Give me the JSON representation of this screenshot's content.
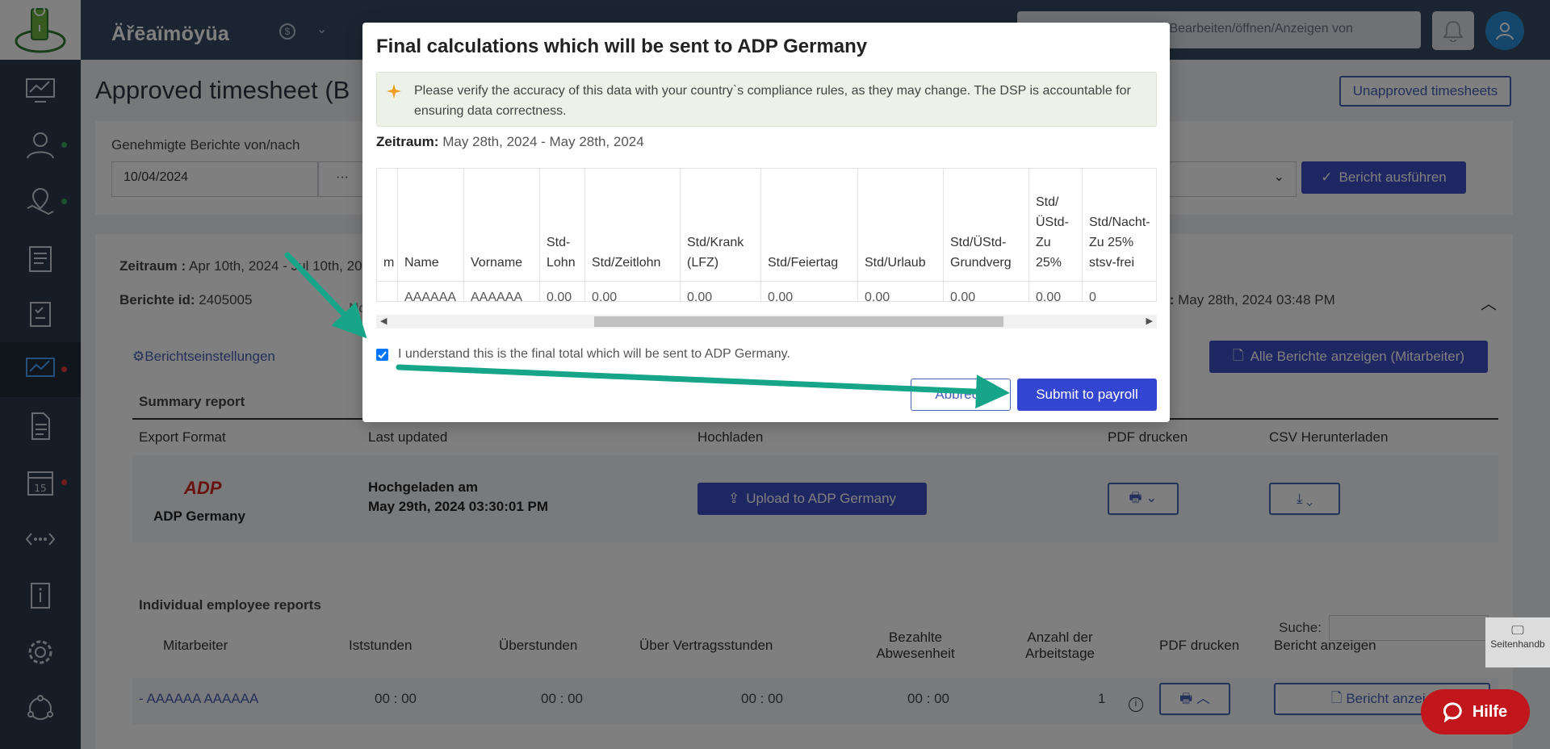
{
  "app": {
    "brand": "Äřēaïmöyüa",
    "search_placeholder": "/Bearbeiten/öffnen/Anzeigen von",
    "help_label": "Hilfe",
    "handbook_label": "Seitenhandb"
  },
  "page": {
    "title": "Approved timesheet (B",
    "unapproved_button": "Unapproved timesheets",
    "filter_label": "Genehmigte Berichte von/nach",
    "date_from": "10/04/2024",
    "date_sep": "···",
    "run_report_button": "Bericht ausführen",
    "period_label": "Zeitraum :",
    "period_value": "Apr 10th, 2024 - Jul 10th, 20",
    "report_id_label": "Berichte id:",
    "report_id_value": "2405005",
    "report_id_extra": "No",
    "date_right_label": "i:",
    "date_right_value": "May 28th, 2024 03:48 PM",
    "settings_link": "Berichtseinstellungen",
    "all_reports_button": "Alle Berichte anzeigen (Mitarbeiter)"
  },
  "summary": {
    "title": "Summary report",
    "headers": [
      "Export Format",
      "Last updated",
      "Hochladen",
      "PDF drucken",
      "CSV Herunterladen"
    ],
    "export_name": "ADP Germany",
    "uploaded_line1": "Hochgeladen am",
    "uploaded_line2": "May 29th, 2024 03:30:01 PM",
    "upload_button": "Upload to ADP Germany"
  },
  "individual": {
    "title": "Individual employee reports",
    "search_label": "Suche:",
    "headers": [
      "Mitarbeiter",
      "Iststunden",
      "Überstunden",
      "Über Vertragsstunden",
      "Bezahlte Abwesenheit",
      "Anzahl der Arbeitstage",
      "PDF drucken",
      "Bericht anzeigen"
    ],
    "row": {
      "employee": "- AAAAAA AAAAAA",
      "ist": "00 : 00",
      "ueber": "00 : 00",
      "vertrag": "00 : 00",
      "abwesenheit": "00 : 00",
      "tage": "1",
      "view_button": "Bericht anzeig"
    }
  },
  "modal": {
    "title": "Final calculations which will be sent to ADP Germany",
    "notice": "Please verify the accuracy of this data with your country`s compliance rules, as they may change. The DSP is accountable for ensuring data correctness.",
    "period_label": "Zeitraum:",
    "period_value": "May 28th, 2024 - May 28th, 2024",
    "columns": [
      "m",
      "Name",
      "Vorname",
      "Std-\nLohn",
      "Std/Zeitlohn",
      "Std/Krank\n(LFZ)",
      "Std/Feiertag",
      "Std/Urlaub",
      "Std/ÜStd-\nGrundverg",
      "Std/\nÜStd-\nZu\n25%",
      "Std/Nacht-\nZu 25%\nstsv-frei"
    ],
    "row": [
      "",
      "AAAAAA",
      "AAAAAA",
      "0,00",
      "0,00",
      "0,00",
      "0,00",
      "0,00",
      "0,00",
      "0,00",
      "0"
    ],
    "confirm_text": "I understand this is the final total which will be sent to ADP Germany.",
    "confirm_checked": true,
    "cancel_button": "Abbrech",
    "submit_button": "Submit to payroll"
  },
  "colors": {
    "sidebar": "#2c3a4d",
    "topbar": "#374a62",
    "primary": "#3346d1",
    "annotation_arrow": "#17a589",
    "help": "#c0161c"
  }
}
